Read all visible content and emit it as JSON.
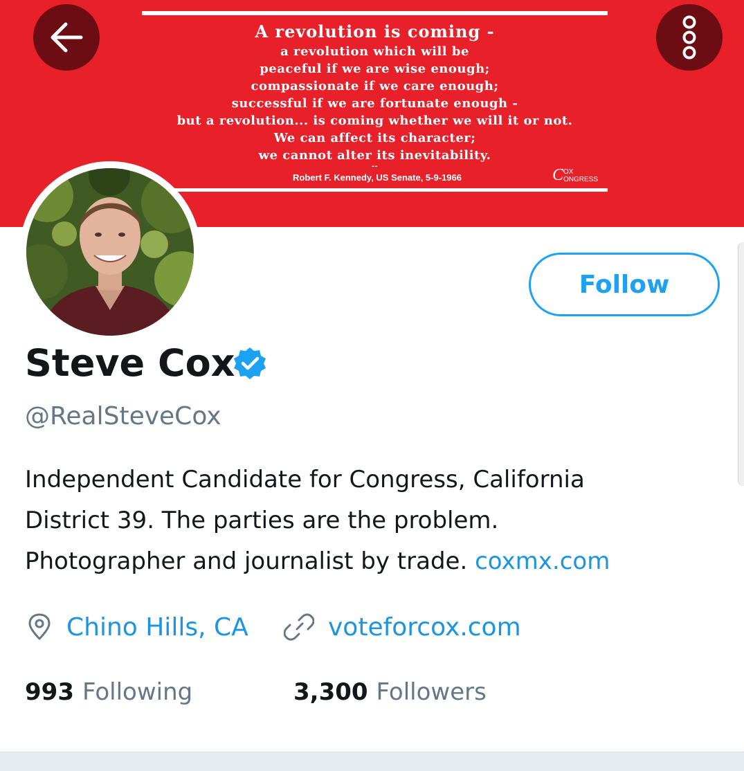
{
  "header": {
    "banner": {
      "background_color": "#e8202a",
      "quote_lines": [
        "A revolution is coming -",
        "a revolution which will be",
        "peaceful if we are wise enough;",
        "compassionate if we care enough;",
        "successful if we are fortunate enough -",
        "but a revolution... is coming whether we will it or not.",
        "We can affect its character;",
        "we cannot alter its inevitability.",
        "--"
      ],
      "attribution": "Robert F. Kennedy, US Senate, 5-9-1966",
      "logo_top": "OX",
      "logo_bottom": "ONGRESS",
      "logo_letter": "C"
    },
    "back_icon": "arrow-left-icon",
    "more_icon": "more-vertical-icon"
  },
  "profile": {
    "name": "Steve Cox",
    "verified_icon": "verified-badge-icon",
    "handle": "@RealSteveCox",
    "follow_label": "Follow",
    "bio_lines": [
      "Independent Candidate for Congress, California",
      "District 39. The parties are the problem.",
      "Photographer and journalist by trade."
    ],
    "bio_link": "coxmx.com",
    "location": "Chino Hills, CA",
    "location_icon": "location-pin-icon",
    "website": "voteforcox.com",
    "website_icon": "link-icon",
    "following_count": "993",
    "following_label": "Following",
    "followers_count": "3,300",
    "followers_label": "Followers"
  },
  "colors": {
    "accent": "#1da1f2",
    "link": "#1b95e0",
    "muted": "#657786",
    "button_dark": "#6b0d12"
  }
}
